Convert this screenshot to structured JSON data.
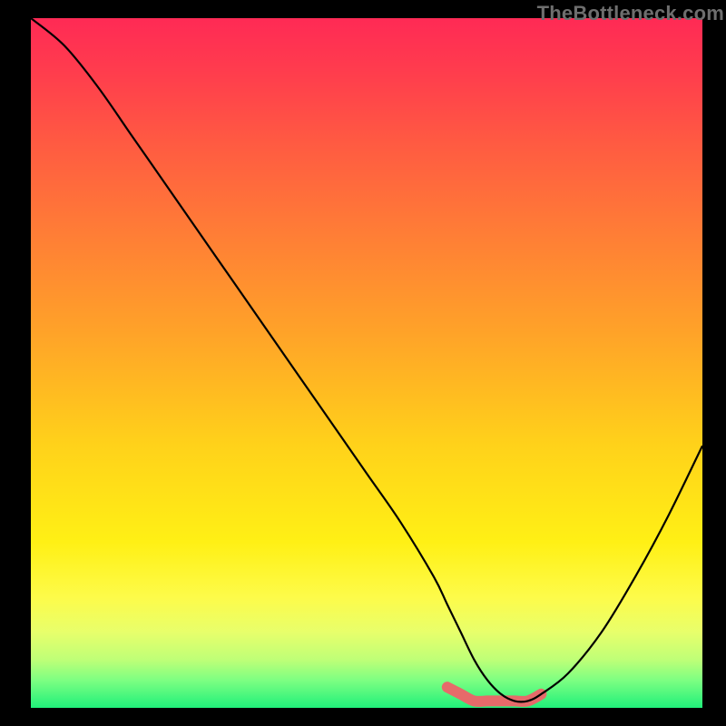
{
  "watermark": "TheBottleneck.com",
  "colors": {
    "frame_bg": "#000000",
    "curve": "#000000",
    "highlight": "#e66a6a",
    "gradient_top": "#ff2a55",
    "gradient_bottom": "#20f07a"
  },
  "chart_data": {
    "type": "line",
    "title": "",
    "xlabel": "",
    "ylabel": "",
    "xlim": [
      0,
      100
    ],
    "ylim": [
      0,
      100
    ],
    "grid": false,
    "legend": false,
    "series": [
      {
        "name": "bottleneck-curve",
        "x": [
          0,
          5,
          10,
          15,
          20,
          25,
          30,
          35,
          40,
          45,
          50,
          55,
          60,
          62,
          64,
          66,
          68,
          70,
          72,
          74,
          76,
          80,
          85,
          90,
          95,
          100
        ],
        "values": [
          100,
          96,
          90,
          83,
          76,
          69,
          62,
          55,
          48,
          41,
          34,
          27,
          19,
          15,
          11,
          7,
          4,
          2,
          1,
          1,
          2,
          5,
          11,
          19,
          28,
          38
        ]
      },
      {
        "name": "optimal-range-highlight",
        "x": [
          62,
          64,
          66,
          68,
          70,
          72,
          74,
          76
        ],
        "values": [
          3,
          2,
          1,
          1,
          1,
          1,
          1,
          2
        ]
      }
    ],
    "annotations": []
  }
}
